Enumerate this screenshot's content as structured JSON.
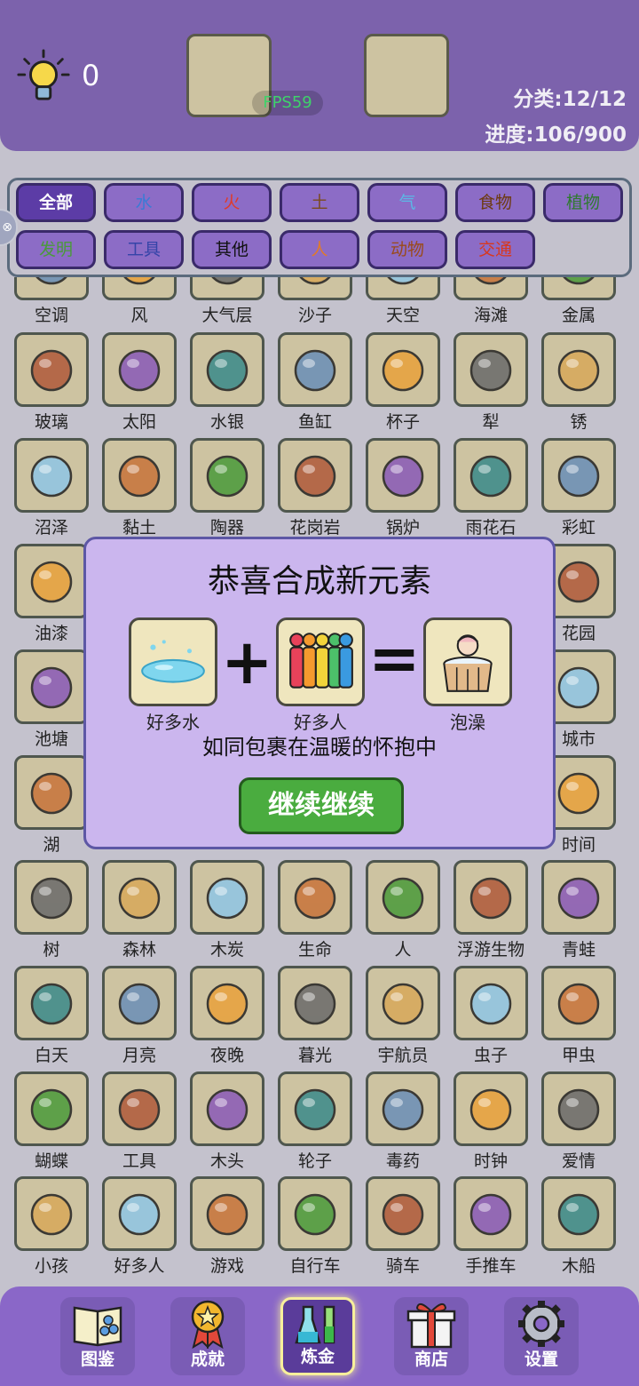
{
  "header": {
    "hint_icon": "lightbulb-icon",
    "hint_count": "0",
    "fps": "FPS59",
    "category": "分类:12/12",
    "progress": "进度:106/900"
  },
  "filters": [
    {
      "label": "全部",
      "color": "#ffffff",
      "active": true
    },
    {
      "label": "水",
      "color": "#3a7bd5"
    },
    {
      "label": "火",
      "color": "#e03a2a"
    },
    {
      "label": "土",
      "color": "#7a4a1e"
    },
    {
      "label": "气",
      "color": "#5bb8e6"
    },
    {
      "label": "食物",
      "color": "#6d3a10"
    },
    {
      "label": "植物",
      "color": "#2f7a2f"
    },
    {
      "label": "发明",
      "color": "#4a9a3a"
    },
    {
      "label": "工具",
      "color": "#3544a8"
    },
    {
      "label": "其他",
      "color": "#111111"
    },
    {
      "label": "人",
      "color": "#e07a2a"
    },
    {
      "label": "动物",
      "color": "#9a4a1a"
    },
    {
      "label": "交通",
      "color": "#d8381e"
    }
  ],
  "grid": [
    [
      "空调",
      "风",
      "大气层",
      "沙子",
      "天空",
      "海滩",
      "金属"
    ],
    [
      "玻璃",
      "太阳",
      "水银",
      "鱼缸",
      "杯子",
      "犁",
      "锈"
    ],
    [
      "沼泽",
      "黏土",
      "陶器",
      "花岗岩",
      "锅炉",
      "雨花石",
      "彩虹"
    ],
    [
      "油漆",
      "",
      "",
      "",
      "",
      "",
      "花园"
    ],
    [
      "池塘",
      "",
      "",
      "",
      "",
      "",
      "城市"
    ],
    [
      "湖",
      "",
      "",
      "",
      "",
      "",
      "时间"
    ],
    [
      "树",
      "森林",
      "木炭",
      "生命",
      "人",
      "浮游生物",
      "青蛙"
    ],
    [
      "白天",
      "月亮",
      "夜晚",
      "暮光",
      "宇航员",
      "虫子",
      "甲虫"
    ],
    [
      "蝴蝶",
      "工具",
      "木头",
      "轮子",
      "毒药",
      "时钟",
      "爱情"
    ],
    [
      "小孩",
      "好多人",
      "游戏",
      "自行车",
      "骑车",
      "手推车",
      "木船"
    ]
  ],
  "modal": {
    "title": "恭喜合成新元素",
    "input1": "好多水",
    "input2": "好多人",
    "result": "泡澡",
    "plus": "+",
    "equals": "=",
    "description": "如同包裹在温暖的怀抱中",
    "button": "继续继续"
  },
  "nav": [
    {
      "label": "图鉴",
      "icon": "book-icon"
    },
    {
      "label": "成就",
      "icon": "medal-icon"
    },
    {
      "label": "炼金",
      "icon": "flask-icon",
      "active": true
    },
    {
      "label": "商店",
      "icon": "gift-icon"
    },
    {
      "label": "设置",
      "icon": "gear-icon"
    }
  ]
}
